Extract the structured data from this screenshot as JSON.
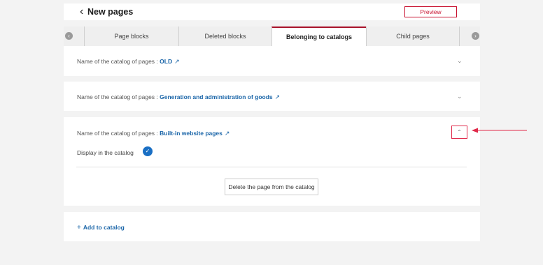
{
  "header": {
    "title": "New pages",
    "back_icon": "chevron-left-icon",
    "preview_label": "Preview"
  },
  "tabs": [
    {
      "label": "Page blocks",
      "active": false
    },
    {
      "label": "Deleted blocks",
      "active": false
    },
    {
      "label": "Belonging to catalogs",
      "active": true
    },
    {
      "label": "Child pages",
      "active": false
    }
  ],
  "tab_nav": {
    "prev_icon": "chevron-left-icon",
    "next_icon": "chevron-right-icon"
  },
  "catalogs": [
    {
      "prefix": "Name of the catalog of pages :",
      "name": "OLD",
      "link_icon": "↗",
      "state": "collapsed"
    },
    {
      "prefix": "Name of the catalog of pages :",
      "name": "Generation and administration of goods",
      "link_icon": "↗",
      "state": "collapsed"
    },
    {
      "prefix": "Name of the catalog of pages :",
      "name": "Built-in website pages",
      "link_icon": "↗",
      "state": "expanded",
      "display_label": "Display in the catalog",
      "display_checked": true,
      "delete_label": "Delete the page from the catalog"
    }
  ],
  "add_catalog": {
    "plus": "+",
    "label": "Add to catalog"
  },
  "colors": {
    "accent": "#c8102e",
    "link": "#1a65a8",
    "toggle": "#1a6fc4",
    "annotation_arrow": "#e0294a"
  }
}
